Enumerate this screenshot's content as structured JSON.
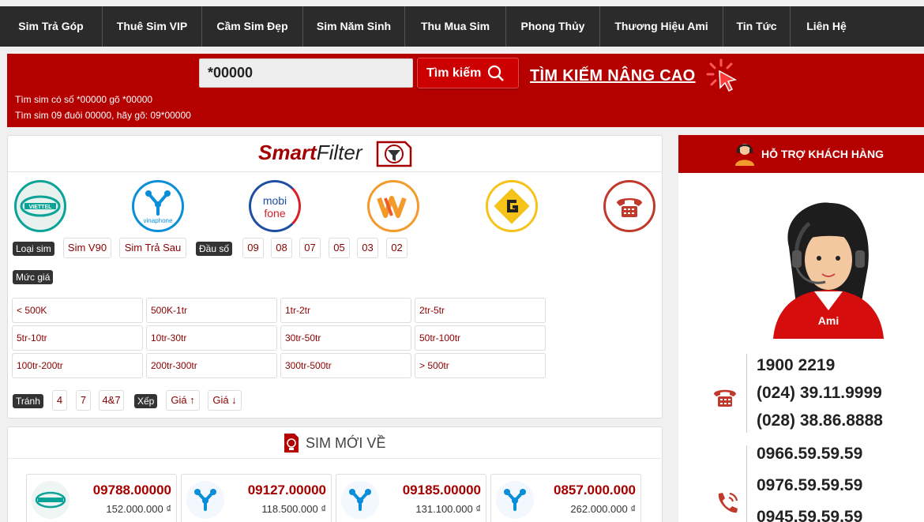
{
  "nav": {
    "items": [
      {
        "label": "Sim Trả Góp",
        "width": 130
      },
      {
        "label": "Thuê Sim VIP",
        "width": 126
      },
      {
        "label": "Cầm Sim Đẹp",
        "width": 128
      },
      {
        "label": "Sim Năm Sinh",
        "width": 129
      },
      {
        "label": "Thu Mua Sim",
        "width": 128
      },
      {
        "label": "Phong Thủy",
        "width": 119
      },
      {
        "label": "Thương Hiệu Ami",
        "width": 156
      },
      {
        "label": "Tin Tức",
        "width": 85
      },
      {
        "label": "Liên Hệ",
        "width": 91
      }
    ]
  },
  "search": {
    "value": "*00000",
    "button_label": "Tìm kiếm",
    "advanced_label": "TÌM KIẾM NÂNG CAO",
    "hint_1": "Tìm sim có số *00000 gõ *00000",
    "hint_2": "Tìm sim 09 đuôi 00000, hãy gõ: 09*00000"
  },
  "smartfilter": {
    "title_bold": "Smart",
    "title_rest": "Filter",
    "sim_type_label": "Loại sim",
    "sim_types": [
      "Sim V90",
      "Sim Trả Sau"
    ],
    "prefix_label": "Đầu số",
    "prefixes": [
      "09",
      "08",
      "07",
      "05",
      "03",
      "02"
    ],
    "price_label": "Mức giá",
    "price_ranges": [
      "< 500K",
      "500K-1tr",
      "1tr-2tr",
      "2tr-5tr",
      "5tr-10tr",
      "10tr-30tr",
      "30tr-50tr",
      "50tr-100tr",
      "100tr-200tr",
      "200tr-300tr",
      "300tr-500tr",
      "> 500tr"
    ],
    "avoid_label": "Tránh",
    "avoid": [
      "4",
      "7",
      "4&7"
    ],
    "sort_label": "Xếp",
    "sort": [
      "Giá ↑",
      "Giá ↓"
    ],
    "carriers": {
      "viettel": "VIETTEL",
      "vinaphone": "vinaphone",
      "mobifone_1": "mobi",
      "mobifone_2": "fone"
    }
  },
  "new_sims": {
    "title": "SIM MỚI VỀ",
    "items": [
      {
        "number": "09788.00000",
        "price": "152.000.000 ₫",
        "carrier": "viettel"
      },
      {
        "number": "09127.00000",
        "price": "118.500.000 ₫",
        "carrier": "vinaphone"
      },
      {
        "number": "09185.00000",
        "price": "131.100.000 ₫",
        "carrier": "vinaphone"
      },
      {
        "number": "0857.000.000",
        "price": "262.000.000 ₫",
        "carrier": "vinaphone"
      }
    ]
  },
  "support": {
    "title": "HỖ TRỢ KHÁCH HÀNG",
    "landlines": [
      "1900 2219",
      "(024) 39.11.9999",
      "(028) 38.86.8888"
    ],
    "mobiles": [
      "0966.59.59.59",
      "0976.59.59.59",
      "0945.59.59.59"
    ],
    "avatar_brand": "Ami"
  },
  "colors": {
    "primary_red": "#b50000",
    "nav_dark": "#2b2b2b"
  }
}
